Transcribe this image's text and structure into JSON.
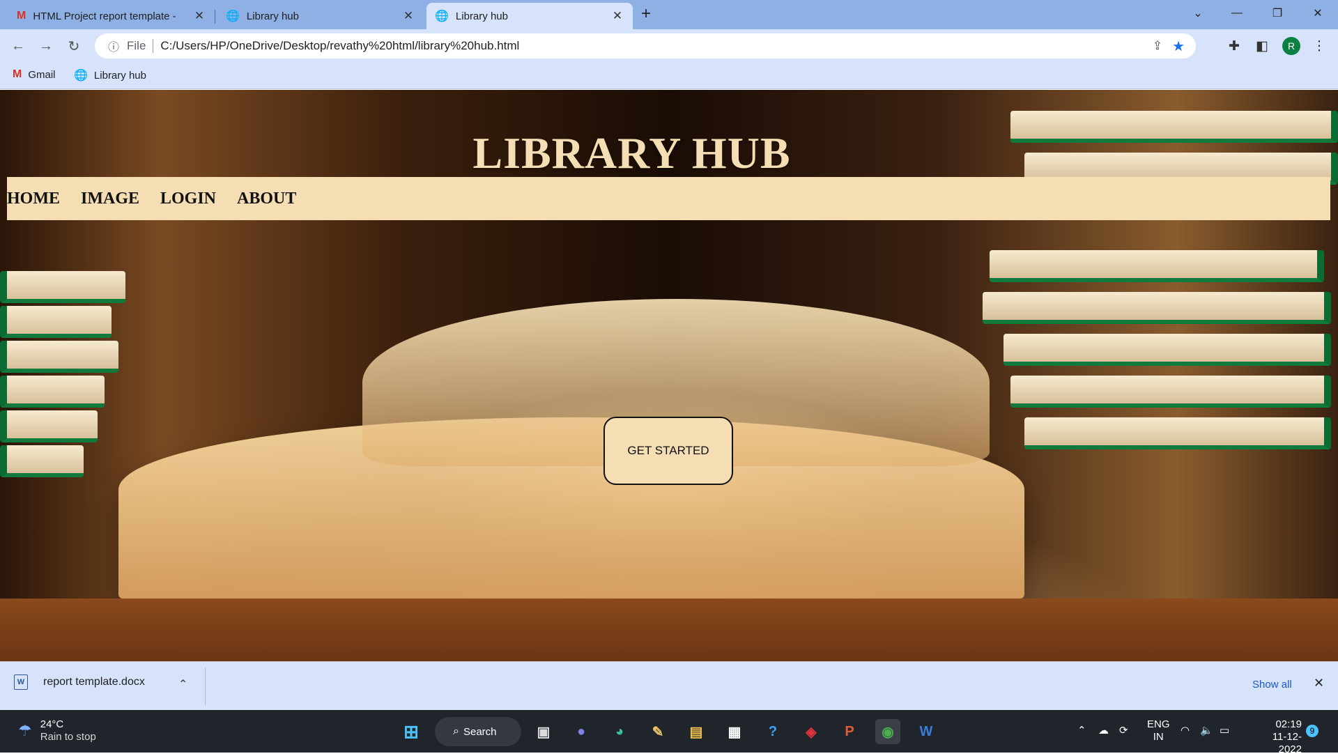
{
  "browser": {
    "tabs": [
      {
        "title": "HTML Project report template - ",
        "icon": "gmail-icon",
        "active": false
      },
      {
        "title": "Library hub",
        "icon": "globe-icon",
        "active": false
      },
      {
        "title": "Library hub",
        "icon": "globe-icon",
        "active": true
      }
    ],
    "new_tab_glyph": "+",
    "address": {
      "scheme_label": "File",
      "url": "C:/Users/HP/OneDrive/Desktop/revathy%20html/library%20hub.html"
    },
    "profile_initial": "R",
    "bookmarks": [
      {
        "label": "Gmail",
        "icon": "gmail-icon"
      },
      {
        "label": "Library hub",
        "icon": "globe-icon"
      }
    ]
  },
  "page": {
    "title": "LIBRARY HUB",
    "nav": [
      "HOME",
      "IMAGE",
      "LOGIN",
      "ABOUT"
    ],
    "cta": "GET STARTED",
    "colors": {
      "accent": "#f5deb3",
      "text": "#111111"
    }
  },
  "downloads": {
    "file": "report template.docx",
    "show_all": "Show all"
  },
  "taskbar": {
    "weather": {
      "temp": "24°C",
      "desc": "Rain to stop"
    },
    "search_label": "Search",
    "lang": "ENG",
    "region": "IN",
    "time": "02:19",
    "date": "11-12-2022",
    "notification_count": "9"
  }
}
